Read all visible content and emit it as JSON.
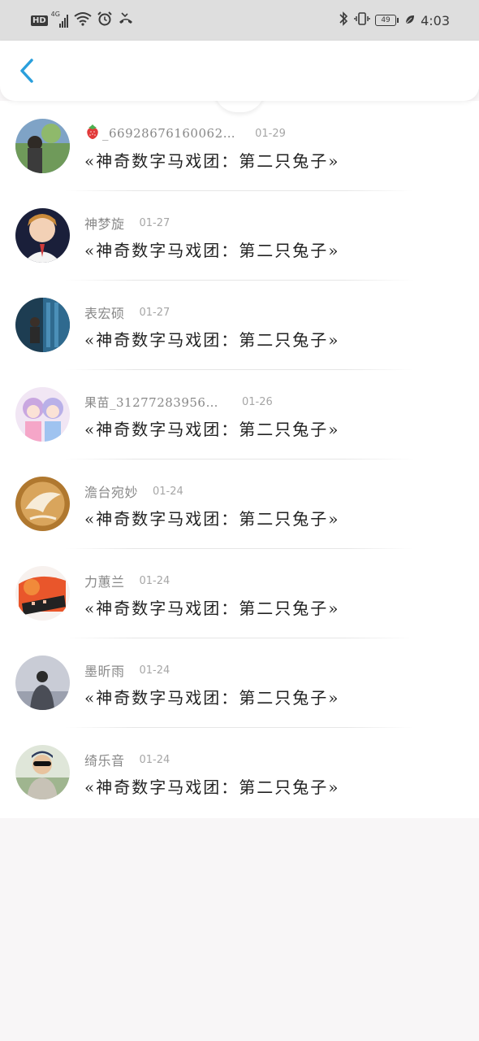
{
  "status_bar": {
    "network": "HD",
    "signal_type": "4G",
    "battery": "49",
    "time": "4:03"
  },
  "header": {
    "back_icon": "chevron-left-icon",
    "accent": "#2a9fdc"
  },
  "comments": [
    {
      "user": "_66928676160062…",
      "date": "01-29",
      "title": "«神奇数字马戏团：第二只兔子»",
      "avatar_icon": "avatar-photo-icon",
      "prefix_icon": "strawberry-icon"
    },
    {
      "user": "神梦旋",
      "date": "01-27",
      "title": "«神奇数字马戏团：第二只兔子»",
      "avatar_icon": "avatar-illustration-icon"
    },
    {
      "user": "表宏硕",
      "date": "01-27",
      "title": "«神奇数字马戏团：第二只兔子»",
      "avatar_icon": "avatar-photo-icon"
    },
    {
      "user": "果苗_312772839567…",
      "date": "01-26",
      "title": "«神奇数字马戏团：第二只兔子»",
      "avatar_icon": "avatar-anime-icon"
    },
    {
      "user": "澹台宛妙",
      "date": "01-24",
      "title": "«神奇数字马戏团：第二只兔子»",
      "avatar_icon": "avatar-coffee-icon"
    },
    {
      "user": "力蕙兰",
      "date": "01-24",
      "title": "«神奇数字马戏团：第二只兔子»",
      "avatar_icon": "avatar-photo-icon"
    },
    {
      "user": "墨昕雨",
      "date": "01-24",
      "title": "«神奇数字马戏团：第二只兔子»",
      "avatar_icon": "avatar-photo-icon"
    },
    {
      "user": "绮乐音",
      "date": "01-24",
      "title": "«神奇数字马戏团：第二只兔子»",
      "avatar_icon": "avatar-photo-icon"
    }
  ]
}
